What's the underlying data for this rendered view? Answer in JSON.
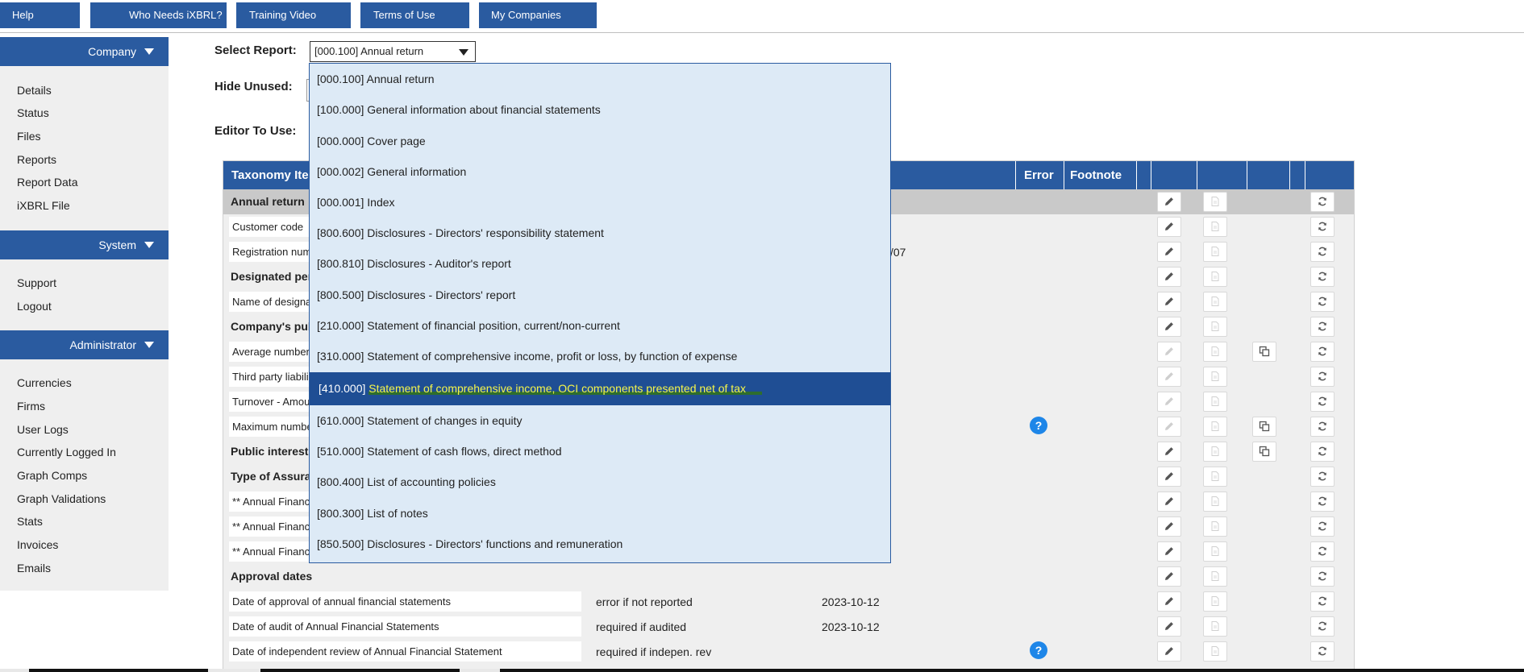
{
  "nav": {
    "buttons": [
      "Help",
      "Who Needs iXBRL?",
      "Training Video",
      "Terms of Use",
      "My Companies"
    ]
  },
  "sidebar": {
    "company": {
      "header": "Company",
      "items": [
        "Details",
        "Status",
        "Files",
        "Reports",
        "Report Data",
        "iXBRL File"
      ]
    },
    "system": {
      "header": "System",
      "items": [
        "Support",
        "Logout"
      ]
    },
    "administrator": {
      "header": "Administrator",
      "items": [
        "Currencies",
        "Firms",
        "User Logs",
        "Currently Logged In",
        "Graph Comps",
        "Graph Validations",
        "Stats",
        "Invoices",
        "Emails"
      ]
    }
  },
  "form": {
    "select_report_label": "Select Report:",
    "select_report_value": "[000.100] Annual return",
    "hide_unused_label": "Hide Unused:",
    "editor_label": "Editor To Use:"
  },
  "dropdown": {
    "selected_index": 10,
    "options": [
      "[000.100] Annual return",
      "[100.000] General information about financial statements",
      "[000.000] Cover page",
      "[000.002] General information",
      "[000.001] Index",
      "[800.600] Disclosures - Directors' responsibility statement",
      "[800.810] Disclosures - Auditor's report",
      "[800.500] Disclosures - Directors' report",
      "[210.000] Statement of financial position, current/non-current",
      "[310.000] Statement of comprehensive income, profit or loss, by function of expense",
      "[410.000] Statement of comprehensive income, OCI components presented net of tax",
      "[610.000] Statement of changes in equity",
      "[510.000] Statement of cash flows, direct method",
      "[800.400] List of accounting policies",
      "[800.300] List of notes",
      "[850.500] Disclosures - Directors' functions and remuneration"
    ],
    "selected_code": "[410.000]",
    "selected_text": "Statement of comprehensive income, OCI components presented net of tax"
  },
  "table": {
    "headers": {
      "taxonomy": "Taxonomy Ite",
      "error": "Error",
      "footnote": "Footnote"
    },
    "rows": [
      {
        "type": "group",
        "label": "Annual return",
        "shaded": true
      },
      {
        "type": "item",
        "label": "Customer code"
      },
      {
        "type": "item",
        "label": "Registration num",
        "value": "/07"
      },
      {
        "type": "group",
        "label": "Designated per"
      },
      {
        "type": "item",
        "label": "Name of designa"
      },
      {
        "type": "group",
        "label": "Company's pub"
      },
      {
        "type": "item",
        "label": "Average number",
        "copy": true,
        "edit_disabled": true
      },
      {
        "type": "item",
        "label": "Third party liabili",
        "edit_disabled": true
      },
      {
        "type": "item",
        "label": "Turnover - Amou",
        "edit_disabled": true
      },
      {
        "type": "item",
        "label": "Maximum numbe",
        "help": "?",
        "copy": true,
        "edit_disabled": true
      },
      {
        "type": "group",
        "label": "Public interest",
        "copy": true
      },
      {
        "type": "group",
        "label": "Type of Assura"
      },
      {
        "type": "item",
        "label": "** Annual Financi"
      },
      {
        "type": "item",
        "label": "** Annual Financi"
      },
      {
        "type": "item",
        "label": "** Annual Financi"
      },
      {
        "type": "group",
        "label": "Approval dates"
      },
      {
        "type": "item",
        "label": "Date of approval of annual financial statements",
        "requirement": "error if not reported",
        "value": "2023-10-12"
      },
      {
        "type": "item",
        "label": "Date of audit of Annual Financial Statements",
        "requirement": "required if audited",
        "value": "2023-10-12"
      },
      {
        "type": "item",
        "label": "Date of independent review of Annual Financial Statement",
        "requirement": "required if indepen. rev",
        "help": "?"
      }
    ]
  },
  "icons": {
    "edit": "pencil-icon",
    "note": "document-icon",
    "copy": "copy-icon",
    "reset": "refresh-icon",
    "dropdown": "caret-down-icon"
  },
  "colors": {
    "primary": "#2a5ba0",
    "dropdown_bg": "#ddeaf6",
    "highlight_text": "#f5f54a",
    "help": "#1e86e8"
  }
}
